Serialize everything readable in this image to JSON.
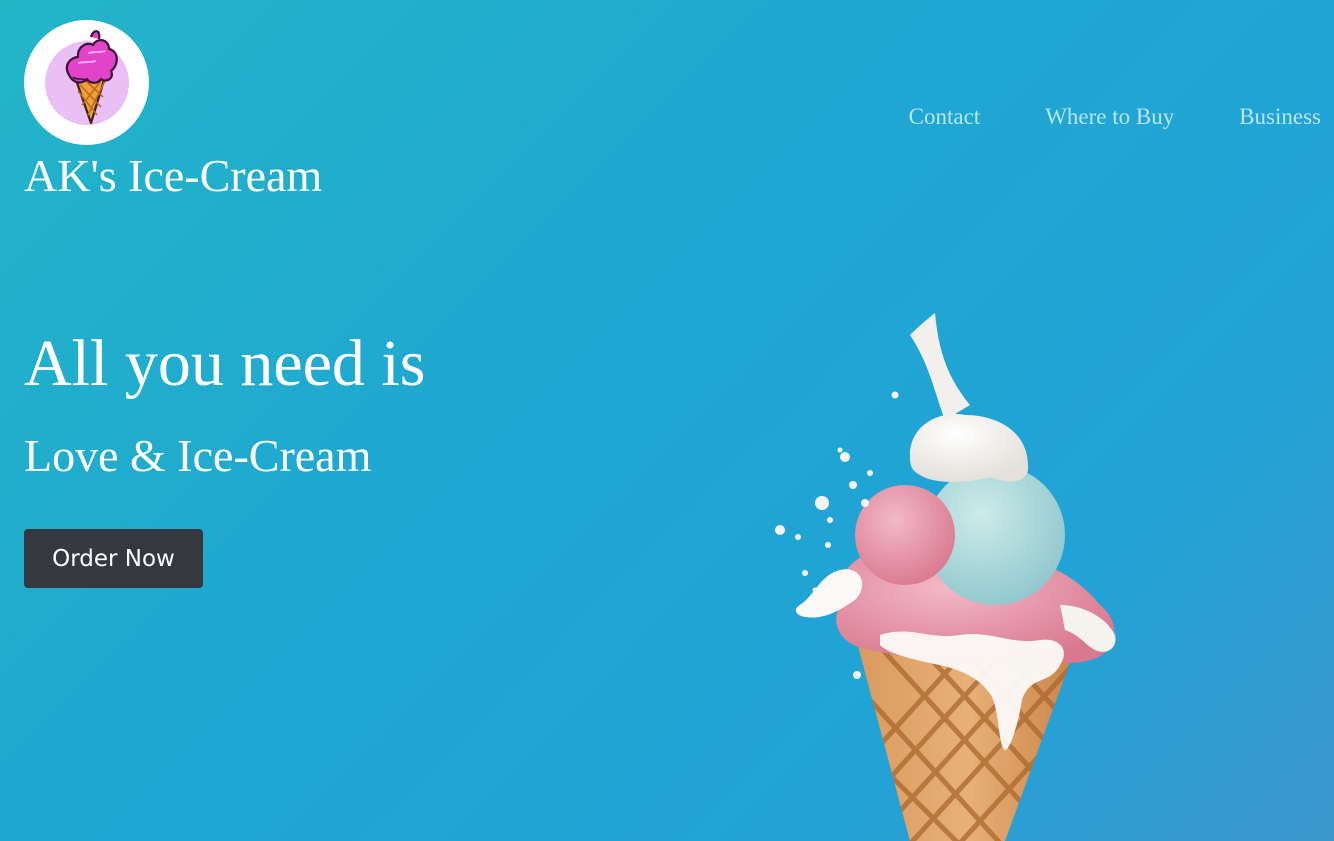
{
  "brand": {
    "name": "AK's Ice-Cream",
    "logo_icon": "ice-cream-cone-icon"
  },
  "nav": {
    "items": [
      {
        "label": "Contact"
      },
      {
        "label": "Where to Buy"
      },
      {
        "label": "Business"
      }
    ]
  },
  "hero": {
    "title": "All you need is",
    "subtitle": "Love & Ice-Cream",
    "cta_label": "Order Now",
    "image": "ice-cream-cone-photo"
  },
  "colors": {
    "background_start": "#22b5c8",
    "background_end": "#3c96cc",
    "nav_text": "#b9e6ef",
    "button_bg": "#35383f",
    "logo_bg": "#e9bff5"
  }
}
